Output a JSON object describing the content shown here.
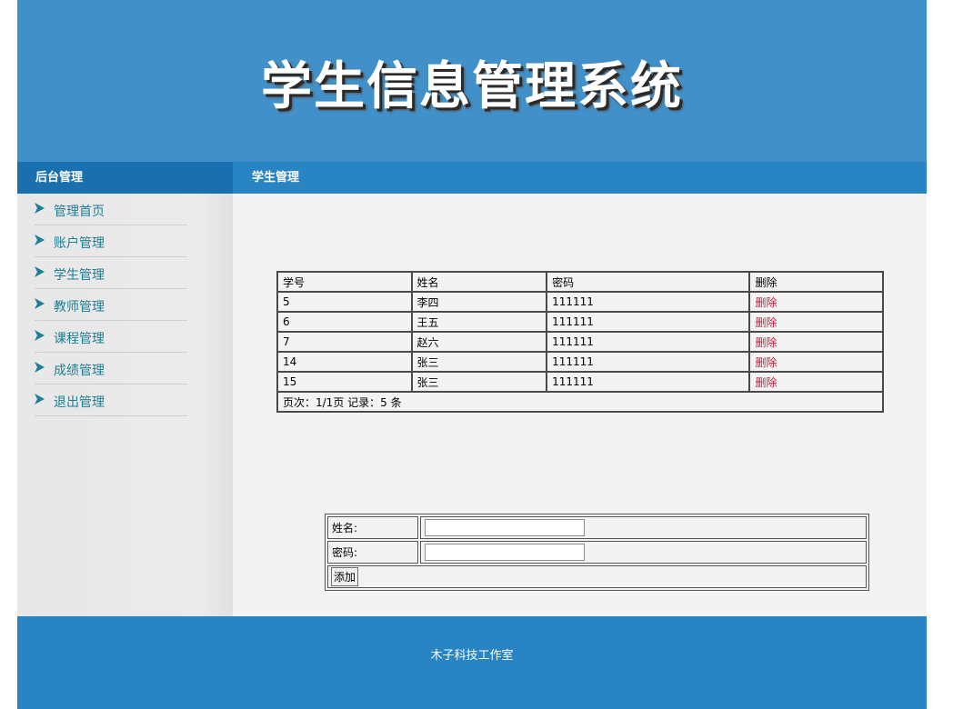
{
  "header": {
    "title": "学生信息管理系统"
  },
  "menu_bar": {
    "sidebar_title": "后台管理",
    "section_title": "学生管理"
  },
  "sidebar": {
    "items": [
      {
        "label": "管理首页",
        "icon": "arrow-right-icon"
      },
      {
        "label": "账户管理",
        "icon": "arrow-right-icon"
      },
      {
        "label": "学生管理",
        "icon": "arrow-right-icon"
      },
      {
        "label": "教师管理",
        "icon": "arrow-right-icon"
      },
      {
        "label": "课程管理",
        "icon": "arrow-right-icon"
      },
      {
        "label": "成绩管理",
        "icon": "arrow-right-icon"
      },
      {
        "label": "退出管理",
        "icon": "arrow-right-icon"
      }
    ]
  },
  "table": {
    "headers": [
      "学号",
      "姓名",
      "密码",
      "删除"
    ],
    "rows": [
      {
        "id": "5",
        "name": "李四",
        "password": "111111",
        "action": "删除"
      },
      {
        "id": "6",
        "name": "王五",
        "password": "111111",
        "action": "删除"
      },
      {
        "id": "7",
        "name": "赵六",
        "password": "111111",
        "action": "删除"
      },
      {
        "id": "14",
        "name": "张三",
        "password": "111111",
        "action": "删除"
      },
      {
        "id": "15",
        "name": "张三",
        "password": "111111",
        "action": "删除"
      }
    ],
    "pagination": "页次：1/1页 记录：5 条"
  },
  "form": {
    "name_label": "姓名:",
    "name_value": "",
    "password_label": "密码:",
    "password_value": "",
    "submit_label": "添加"
  },
  "footer": {
    "text": "木子科技工作室"
  },
  "colors": {
    "banner": "#4190c9",
    "bar": "#2884c3",
    "sidebar_head": "#1a6fae",
    "nav_text": "#1d7e96",
    "delete_link": "#c51b3b"
  }
}
